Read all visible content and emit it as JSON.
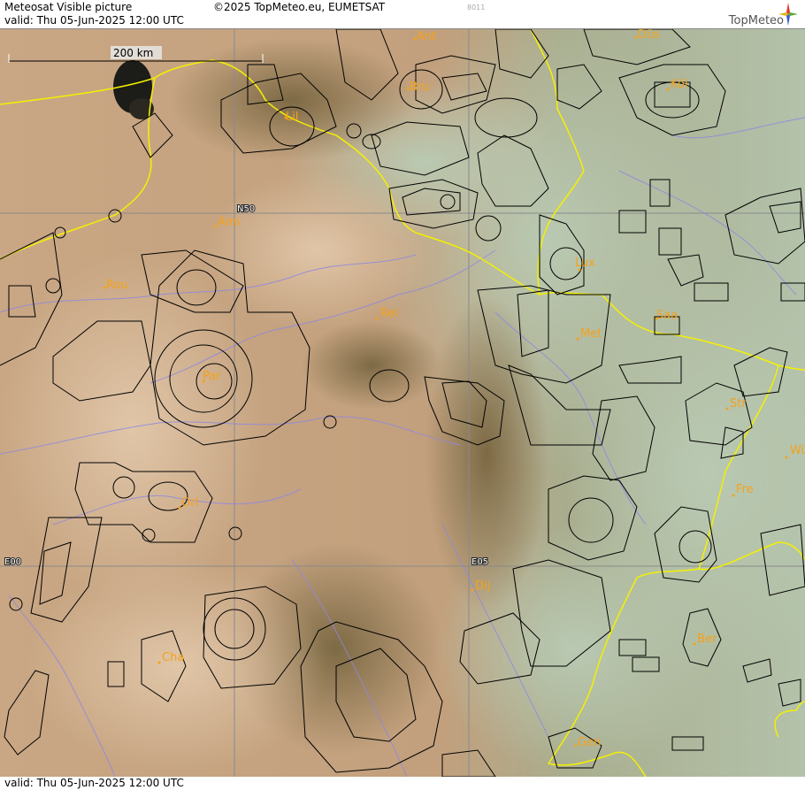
{
  "header": {
    "product": "Meteosat Visible picture",
    "valid": "valid:  Thu  05-Jun-2025  12:00 UTC",
    "copyright": "©2025 TopMeteo.eu, EUMETSAT",
    "code": "8011",
    "brand": "TopMeteo"
  },
  "footer": {
    "valid": "valid:  Thu  05-Jun-2025  12:00 UTC"
  },
  "scale": {
    "label": "200 km"
  },
  "grid": {
    "n50": "N50",
    "e00": "E00",
    "e05": "E05"
  },
  "cities": {
    "ant": "Ant",
    "dus": "Düs",
    "bru": "Bru",
    "kol": "Köl",
    "lil": "Lil",
    "ami": "Ami",
    "rou": "Rou",
    "lux": "Lux",
    "rei": "Rei",
    "saa": "Saa",
    "met": "Met",
    "par": "Par",
    "str": "Str",
    "wu": "Wü",
    "fre": "Fre",
    "orl": "Orl",
    "dij": "Dij",
    "ber": "Ber",
    "cha": "Cha",
    "gen": "Gen"
  },
  "colors": {
    "border": "#f5f000",
    "river": "#8f88e0",
    "airspace": "#000000",
    "grid": "#8a8a8a",
    "city": "#f4a21a"
  }
}
